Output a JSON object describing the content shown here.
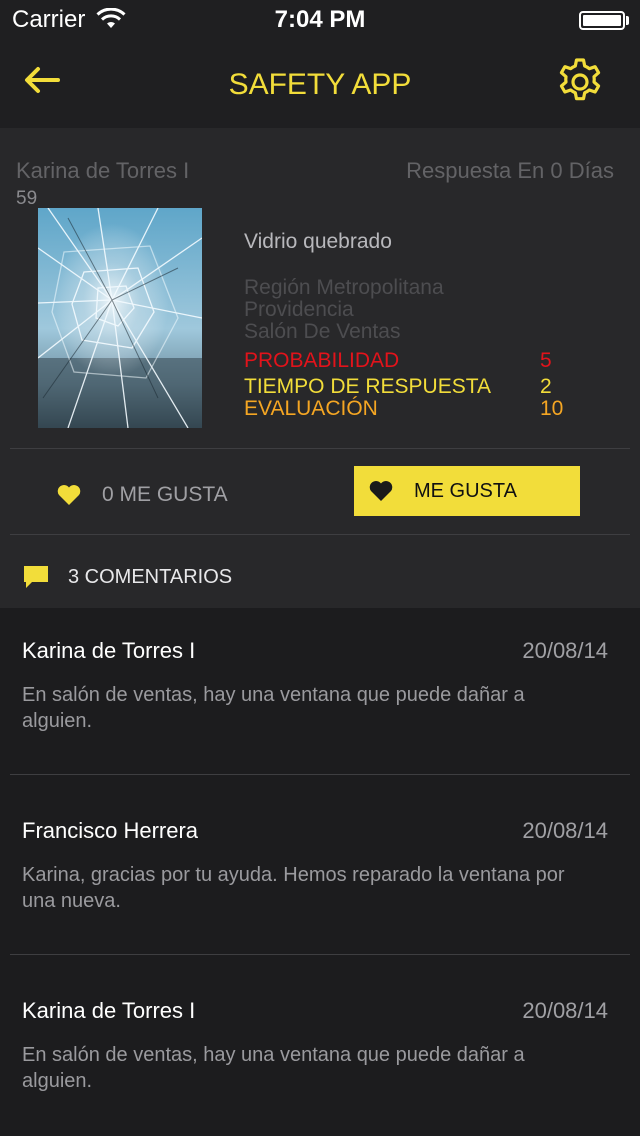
{
  "status_bar": {
    "carrier": "Carrier",
    "time": "7:04 PM"
  },
  "nav": {
    "title": "SAFETY APP"
  },
  "report": {
    "reporter_name": "Karina de Torres I",
    "reporter_count": "59",
    "response_days": "Respuesta En 0 Días",
    "incident_title": "Vidrio quebrado",
    "location": [
      "Región Metropolitana",
      "Providencia",
      "Salón De Ventas"
    ],
    "metrics": [
      {
        "label": "PROBABILIDAD",
        "value": "5",
        "color": "#e2131b"
      },
      {
        "label": "TIEMPO DE RESPUESTA",
        "value": "2",
        "color": "#f2dd3a"
      },
      {
        "label": "EVALUACIÓN",
        "value": "10",
        "color": "#f5a623"
      }
    ],
    "likes_count": "0 ME GUSTA",
    "like_button_label": "ME GUSTA",
    "comments_count": "3 COMENTARIOS"
  },
  "comments": [
    {
      "author": "Karina de Torres I",
      "date": "20/08/14",
      "text": "En salón de ventas, hay una ventana que puede dañar a alguien."
    },
    {
      "author": "Francisco Herrera",
      "date": "20/08/14",
      "text": "Karina, gracias por tu ayuda. Hemos reparado la ventana por una nueva."
    },
    {
      "author": "Karina de Torres I",
      "date": "20/08/14",
      "text": "En salón de ventas, hay una ventana que puede dañar a alguien."
    }
  ],
  "colors": {
    "accent": "#f2dd3a",
    "background": "#1c1c1e",
    "card": "#28282a"
  },
  "icons": [
    "wifi-icon",
    "battery-icon",
    "back-arrow-icon",
    "gear-icon",
    "heart-icon",
    "comment-bubble-icon"
  ]
}
